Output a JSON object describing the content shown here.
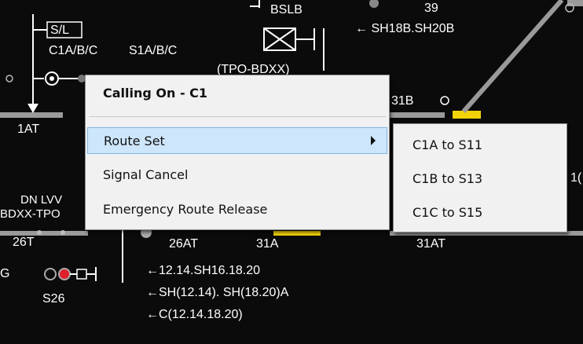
{
  "diagram": {
    "labels": {
      "bslb": "BSLB",
      "num_39": "39",
      "sh_route": "← SH18B.SH20B",
      "sl_box": "S/L",
      "c1abc": "C1A/B/C",
      "s1abc": "S1A/B/C",
      "tpo_bdxx": "(TPO-BDXX)",
      "b31b": "31B",
      "at1": "1AT",
      "dn_lvv": "DN LVV",
      "bdxx_tpo": "BDXX-TPO",
      "t26": "26T",
      "at26": "26AT",
      "a31": "31A",
      "at31": "31AT",
      "s26": "S26",
      "route_a": "←12.14.SH16.18.20",
      "route_b": "←SH(12.14). SH(18.20)A",
      "route_c": "←C(12.14.18.20)",
      "edge_g": "G",
      "edge_10": "1("
    },
    "colors": {
      "background": "#0b0b0b",
      "track": "#9a9a9a",
      "signal_red": "#e0202a",
      "track_yellow": "#f2d20a"
    }
  },
  "context_menu": {
    "title": "Calling On - C1",
    "items": [
      {
        "label": "Route Set",
        "has_submenu": true,
        "highlighted": true
      },
      {
        "label": "Signal Cancel"
      },
      {
        "label": "Emergency Route Release"
      }
    ]
  },
  "submenu": {
    "items": [
      {
        "label": "C1A to S11"
      },
      {
        "label": "C1B to S13"
      },
      {
        "label": "C1C to S15"
      }
    ]
  }
}
